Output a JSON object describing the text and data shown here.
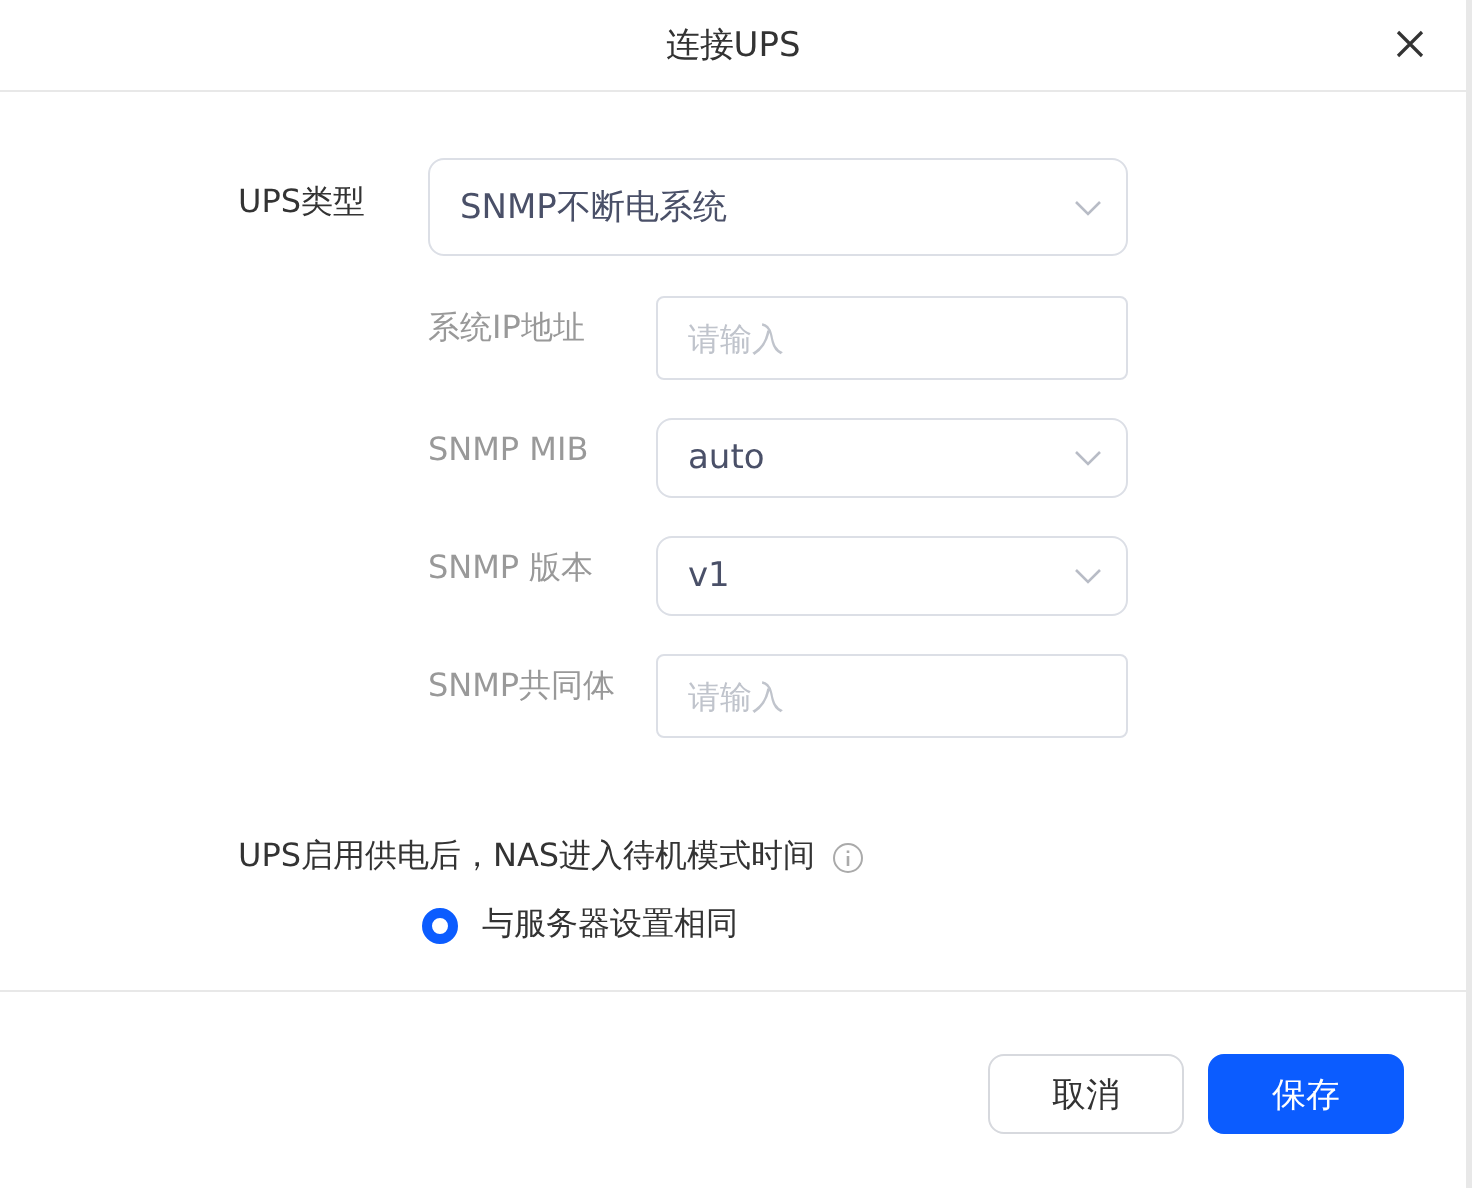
{
  "dialog": {
    "title": "连接UPS"
  },
  "ups_type": {
    "label": "UPS类型",
    "value": "SNMP不断电系统"
  },
  "fields": [
    {
      "kind": "text",
      "label": "系统IP地址",
      "placeholder": "请输入"
    },
    {
      "kind": "select",
      "label": "SNMP MIB",
      "value": "auto"
    },
    {
      "kind": "select",
      "label": "SNMP 版本",
      "value": "v1"
    },
    {
      "kind": "text",
      "label": "SNMP共同体",
      "placeholder": "请输入"
    }
  ],
  "standby": {
    "label": "UPS启用供电后，NAS进入待机模式时间",
    "options": [
      {
        "label": "与服务器设置相同",
        "selected": true
      }
    ]
  },
  "buttons": [
    {
      "kind": "secondary",
      "label": "取消"
    },
    {
      "kind": "primary",
      "label": "保存"
    }
  ]
}
